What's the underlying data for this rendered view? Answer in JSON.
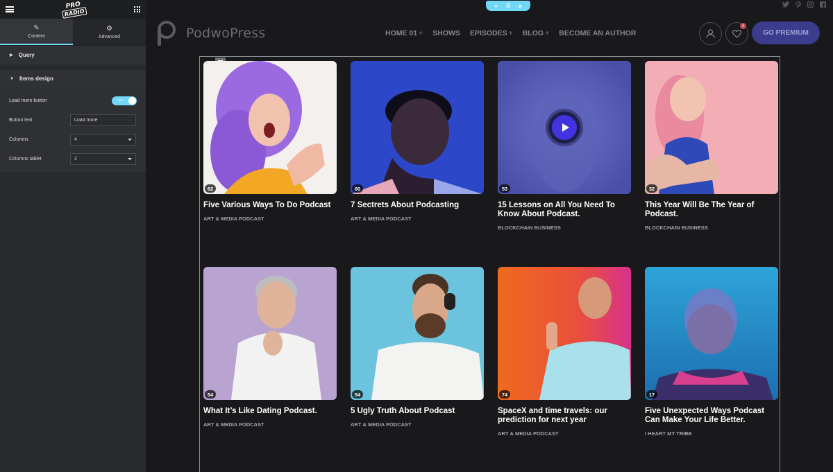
{
  "panel": {
    "brand": {
      "line1": "PRO",
      "line2": "RADIO"
    },
    "tabs": [
      {
        "label": "Content",
        "icon": "pencil-icon"
      },
      {
        "label": "Advanced",
        "icon": "gear-icon"
      }
    ],
    "sections": [
      {
        "label": "Query",
        "expanded": false
      },
      {
        "label": "Items design",
        "expanded": true
      }
    ],
    "controls": {
      "load_more": {
        "label": "Load more button",
        "toggle_text": "YES",
        "value": true
      },
      "button_text": {
        "label": "Button text",
        "value": "Load more"
      },
      "columns": {
        "label": "Columns",
        "value": "4"
      },
      "columns_tablet": {
        "label": "Columns tablet",
        "value": "2"
      }
    },
    "collapse_glyph": "‹"
  },
  "preview": {
    "handle": {
      "add": "+",
      "move": "⠿",
      "close": "×"
    },
    "socials": [
      "twitter-icon",
      "pinterest-icon",
      "instagram-icon",
      "facebook-icon"
    ],
    "logo_text": "PodwoPress",
    "nav": [
      {
        "label": "HOME 01",
        "plus": "+"
      },
      {
        "label": "SHOWS",
        "plus": ""
      },
      {
        "label": "EPISODES",
        "plus": "+"
      },
      {
        "label": "BLOG",
        "plus": "+"
      },
      {
        "label": "BECOME AN AUTHOR",
        "plus": ""
      }
    ],
    "heart_badge": "0",
    "premium_label": "GO PREMIUM",
    "cards": [
      {
        "count": "62",
        "title": "Five Various Ways To Do Podcast",
        "category": "ART & MEDIA PODCAST"
      },
      {
        "count": "60",
        "title": "7 Sectrets About Podcasting",
        "category": "ART & MEDIA PODCAST"
      },
      {
        "count": "53",
        "title": "15 Lessons on All You Need To Know About Podcast.",
        "category": "BLOCKCHAIN BUSINESS"
      },
      {
        "count": "32",
        "title": "This Year Will Be The Year of Podcast.",
        "category": "BLOCKCHAIN BUSINESS"
      },
      {
        "count": "54",
        "title": "What It’s Like Dating Podcast.",
        "category": "ART & MEDIA PODCAST"
      },
      {
        "count": "54",
        "title": "5 Ugly Truth About Podcast",
        "category": "ART & MEDIA PODCAST"
      },
      {
        "count": "74",
        "title": "SpaceX and time travels: our prediction for next year",
        "category": "ART & MEDIA PODCAST"
      },
      {
        "count": "17",
        "title": "Five Unexpected Ways Podcast Can Make Your Life Better.",
        "category": "I HEART MY TRIBE"
      }
    ],
    "colors": {
      "accent": "#71d7f7",
      "premium": "#3b3c8e",
      "background": "#19191b",
      "panel": "#2a2b2e"
    }
  }
}
